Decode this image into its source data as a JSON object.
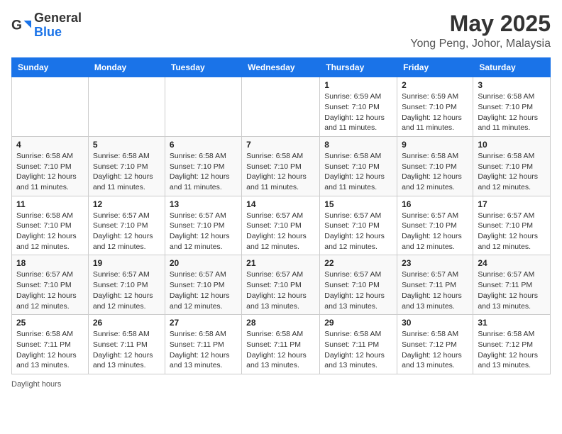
{
  "header": {
    "logo_general": "General",
    "logo_blue": "Blue",
    "month_year": "May 2025",
    "location": "Yong Peng, Johor, Malaysia"
  },
  "days_of_week": [
    "Sunday",
    "Monday",
    "Tuesday",
    "Wednesday",
    "Thursday",
    "Friday",
    "Saturday"
  ],
  "footer": {
    "note": "Daylight hours"
  },
  "weeks": [
    [
      {
        "day": "",
        "info": ""
      },
      {
        "day": "",
        "info": ""
      },
      {
        "day": "",
        "info": ""
      },
      {
        "day": "",
        "info": ""
      },
      {
        "day": "1",
        "info": "Sunrise: 6:59 AM\nSunset: 7:10 PM\nDaylight: 12 hours\nand 11 minutes."
      },
      {
        "day": "2",
        "info": "Sunrise: 6:59 AM\nSunset: 7:10 PM\nDaylight: 12 hours\nand 11 minutes."
      },
      {
        "day": "3",
        "info": "Sunrise: 6:58 AM\nSunset: 7:10 PM\nDaylight: 12 hours\nand 11 minutes."
      }
    ],
    [
      {
        "day": "4",
        "info": "Sunrise: 6:58 AM\nSunset: 7:10 PM\nDaylight: 12 hours\nand 11 minutes."
      },
      {
        "day": "5",
        "info": "Sunrise: 6:58 AM\nSunset: 7:10 PM\nDaylight: 12 hours\nand 11 minutes."
      },
      {
        "day": "6",
        "info": "Sunrise: 6:58 AM\nSunset: 7:10 PM\nDaylight: 12 hours\nand 11 minutes."
      },
      {
        "day": "7",
        "info": "Sunrise: 6:58 AM\nSunset: 7:10 PM\nDaylight: 12 hours\nand 11 minutes."
      },
      {
        "day": "8",
        "info": "Sunrise: 6:58 AM\nSunset: 7:10 PM\nDaylight: 12 hours\nand 11 minutes."
      },
      {
        "day": "9",
        "info": "Sunrise: 6:58 AM\nSunset: 7:10 PM\nDaylight: 12 hours\nand 12 minutes."
      },
      {
        "day": "10",
        "info": "Sunrise: 6:58 AM\nSunset: 7:10 PM\nDaylight: 12 hours\nand 12 minutes."
      }
    ],
    [
      {
        "day": "11",
        "info": "Sunrise: 6:58 AM\nSunset: 7:10 PM\nDaylight: 12 hours\nand 12 minutes."
      },
      {
        "day": "12",
        "info": "Sunrise: 6:57 AM\nSunset: 7:10 PM\nDaylight: 12 hours\nand 12 minutes."
      },
      {
        "day": "13",
        "info": "Sunrise: 6:57 AM\nSunset: 7:10 PM\nDaylight: 12 hours\nand 12 minutes."
      },
      {
        "day": "14",
        "info": "Sunrise: 6:57 AM\nSunset: 7:10 PM\nDaylight: 12 hours\nand 12 minutes."
      },
      {
        "day": "15",
        "info": "Sunrise: 6:57 AM\nSunset: 7:10 PM\nDaylight: 12 hours\nand 12 minutes."
      },
      {
        "day": "16",
        "info": "Sunrise: 6:57 AM\nSunset: 7:10 PM\nDaylight: 12 hours\nand 12 minutes."
      },
      {
        "day": "17",
        "info": "Sunrise: 6:57 AM\nSunset: 7:10 PM\nDaylight: 12 hours\nand 12 minutes."
      }
    ],
    [
      {
        "day": "18",
        "info": "Sunrise: 6:57 AM\nSunset: 7:10 PM\nDaylight: 12 hours\nand 12 minutes."
      },
      {
        "day": "19",
        "info": "Sunrise: 6:57 AM\nSunset: 7:10 PM\nDaylight: 12 hours\nand 12 minutes."
      },
      {
        "day": "20",
        "info": "Sunrise: 6:57 AM\nSunset: 7:10 PM\nDaylight: 12 hours\nand 12 minutes."
      },
      {
        "day": "21",
        "info": "Sunrise: 6:57 AM\nSunset: 7:10 PM\nDaylight: 12 hours\nand 13 minutes."
      },
      {
        "day": "22",
        "info": "Sunrise: 6:57 AM\nSunset: 7:10 PM\nDaylight: 12 hours\nand 13 minutes."
      },
      {
        "day": "23",
        "info": "Sunrise: 6:57 AM\nSunset: 7:11 PM\nDaylight: 12 hours\nand 13 minutes."
      },
      {
        "day": "24",
        "info": "Sunrise: 6:57 AM\nSunset: 7:11 PM\nDaylight: 12 hours\nand 13 minutes."
      }
    ],
    [
      {
        "day": "25",
        "info": "Sunrise: 6:58 AM\nSunset: 7:11 PM\nDaylight: 12 hours\nand 13 minutes."
      },
      {
        "day": "26",
        "info": "Sunrise: 6:58 AM\nSunset: 7:11 PM\nDaylight: 12 hours\nand 13 minutes."
      },
      {
        "day": "27",
        "info": "Sunrise: 6:58 AM\nSunset: 7:11 PM\nDaylight: 12 hours\nand 13 minutes."
      },
      {
        "day": "28",
        "info": "Sunrise: 6:58 AM\nSunset: 7:11 PM\nDaylight: 12 hours\nand 13 minutes."
      },
      {
        "day": "29",
        "info": "Sunrise: 6:58 AM\nSunset: 7:11 PM\nDaylight: 12 hours\nand 13 minutes."
      },
      {
        "day": "30",
        "info": "Sunrise: 6:58 AM\nSunset: 7:12 PM\nDaylight: 12 hours\nand 13 minutes."
      },
      {
        "day": "31",
        "info": "Sunrise: 6:58 AM\nSunset: 7:12 PM\nDaylight: 12 hours\nand 13 minutes."
      }
    ]
  ]
}
